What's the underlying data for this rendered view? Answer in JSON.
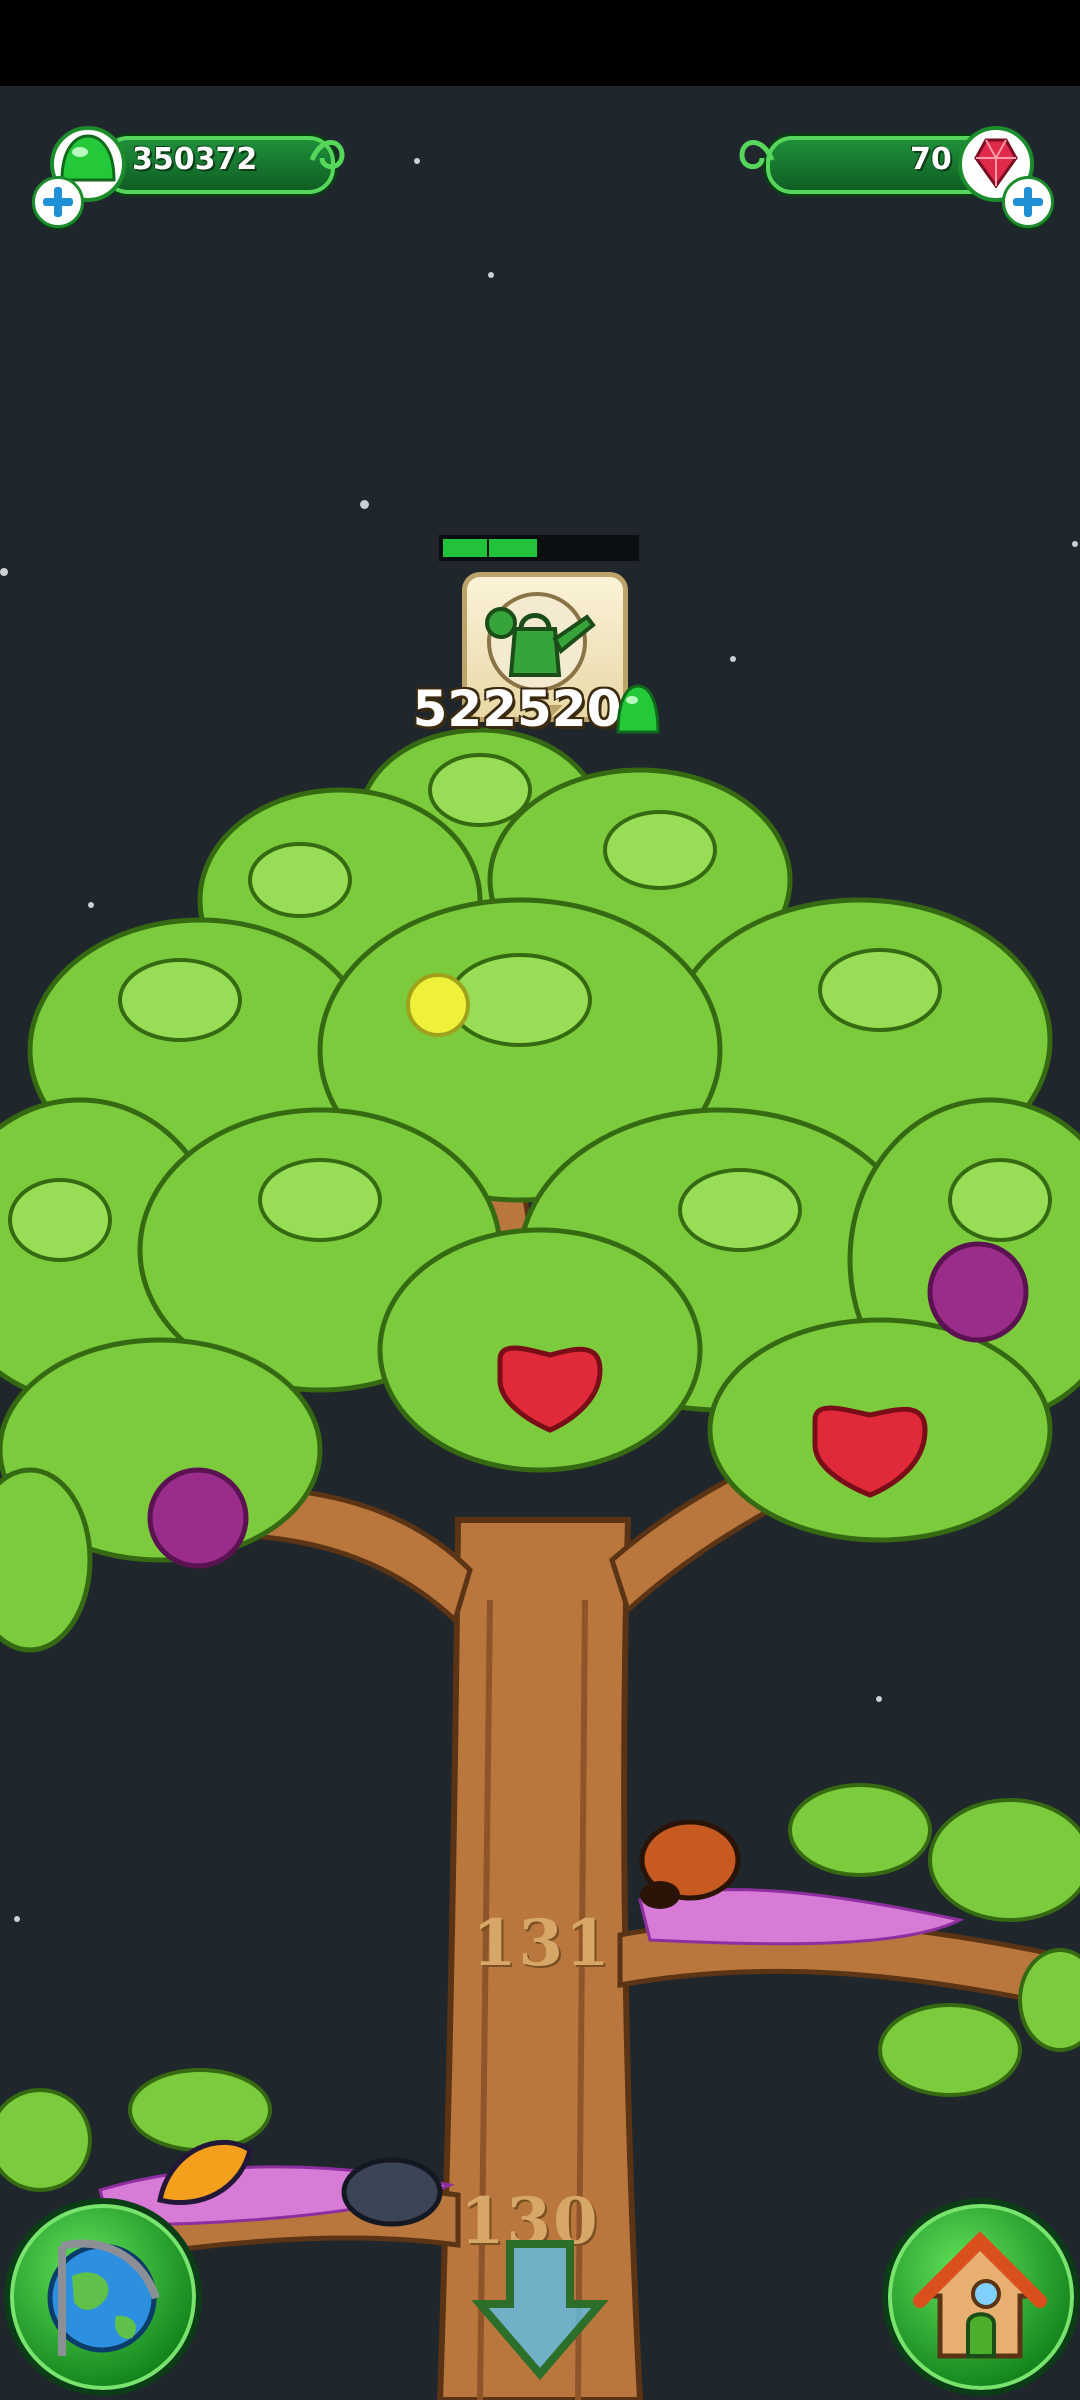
{
  "resources": {
    "jelly_count": "350372",
    "crystal_count": "70"
  },
  "task": {
    "icon": "watering-can-icon",
    "price": "522520",
    "progress": 0.5
  },
  "branches": [
    "131",
    "130"
  ],
  "buttons": {
    "map": "globe-icon",
    "home": "house-icon",
    "scroll_down": "down-arrow-icon"
  },
  "colors": {
    "accent_green": "#22c23a",
    "crystal_red": "#e02a4a",
    "background": "#1f262c"
  }
}
